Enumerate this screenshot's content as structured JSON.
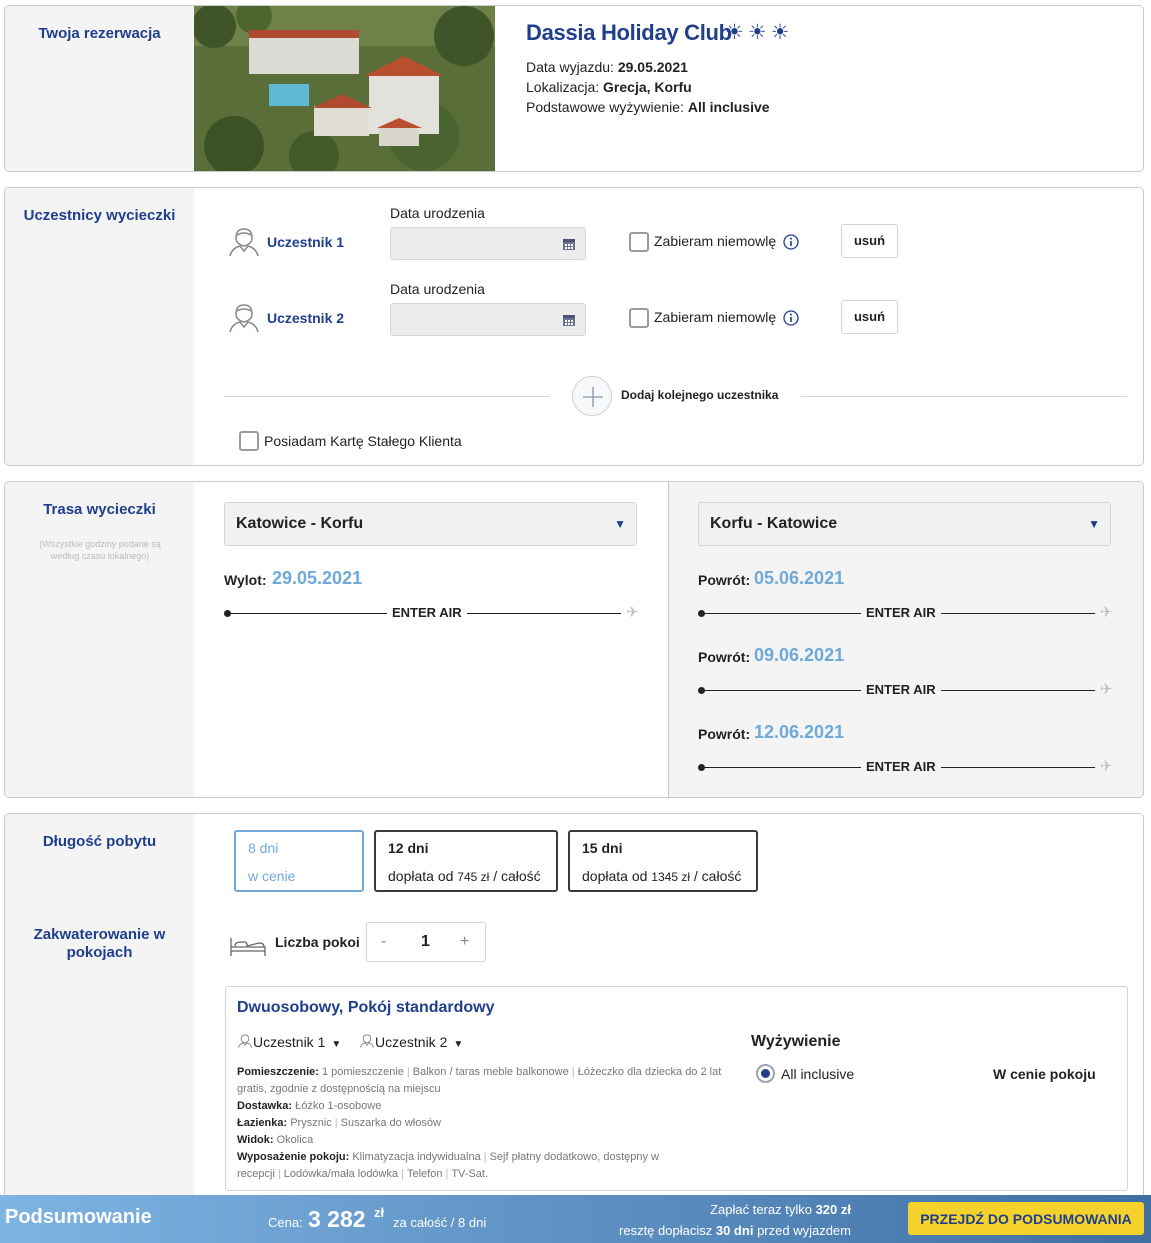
{
  "reservation": {
    "section_title": "Twoja rezerwacja",
    "hotel_name": "Dassia Holiday Club",
    "suns": "☀☀☀",
    "departure_label": "Data wyjazdu:",
    "departure_value": "29.05.2021",
    "location_label": "Lokalizacja:",
    "location_value": "Grecja, Korfu",
    "board_label": "Podstawowe wyżywienie:",
    "board_value": "All inclusive"
  },
  "participants": {
    "section_title": "Uczestnicy wycieczki",
    "items": [
      {
        "label": "Uczestnik 1",
        "dob_label": "Data urodzenia",
        "dob_value": "",
        "infant_label": "Zabieram niemowlę",
        "remove_label": "usuń"
      },
      {
        "label": "Uczestnik 2",
        "dob_label": "Data urodzenia",
        "dob_value": "",
        "infant_label": "Zabieram niemowlę",
        "remove_label": "usuń"
      }
    ],
    "add_label": "Dodaj kolejnego uczestnika",
    "loyalty_label": "Posiadam Kartę Stałego Klienta"
  },
  "route": {
    "section_title": "Trasa wycieczki",
    "note": "(Wszystkie godziny podane są według czasu lokalnego)",
    "outbound": {
      "select": "Katowice - Korfu",
      "label": "Wylot:",
      "date": "29.05.2021",
      "carrier": "ENTER AIR"
    },
    "return": {
      "select": "Korfu - Katowice",
      "flights": [
        {
          "label": "Powrót:",
          "date": "05.06.2021",
          "carrier": "ENTER AIR"
        },
        {
          "label": "Powrót:",
          "date": "09.06.2021",
          "carrier": "ENTER AIR"
        },
        {
          "label": "Powrót:",
          "date": "12.06.2021",
          "carrier": "ENTER AIR"
        }
      ]
    }
  },
  "stay": {
    "section_title": "Długość pobytu",
    "options": [
      {
        "days": "8 dni",
        "price": "w cenie",
        "selected": true
      },
      {
        "days": "12 dni",
        "price_prefix": "dopłata od",
        "amount": "745 zł",
        "suffix": "/ całość"
      },
      {
        "days": "15 dni",
        "price_prefix": "dopłata od",
        "amount": "1345 zł",
        "suffix": "/ całość"
      }
    ]
  },
  "accommodation": {
    "section_title": "Zakwaterowanie w pokojach",
    "rooms_label": "Liczba pokoi",
    "minus": "-",
    "rooms_count": "1",
    "plus": "+",
    "room": {
      "title": "Dwuosobowy, Pokój standardowy",
      "participant_1": "Uczestnik 1",
      "participant_2": "Uczestnik 2",
      "room_label": "Pomieszczenie:",
      "room_items": [
        "1 pomieszczenie",
        "Balkon / taras meble balkonowe",
        "Łóżeczko dla dziecka do 2 lat gratis, zgodnie z dostępnością na miejscu"
      ],
      "bed_label": "Dostawka:",
      "bed_value": "Łóżko 1-osobowe",
      "bath_label": "Łazienka:",
      "bath_items": [
        "Prysznic",
        "Suszarka do włosów"
      ],
      "view_label": "Widok:",
      "view_value": "Okolica",
      "equip_label": "Wyposażenie pokoju:",
      "equip_items": [
        "Klimatyzacja indywidualna",
        "Sejf płatny dodatkowo, dostępny w recepcji",
        "Lodówka/mała lodówka",
        "Telefon",
        "TV-Sat."
      ],
      "meal_heading": "Wyżywienie",
      "meal_option": "All inclusive",
      "meal_price": "W cenie pokoju"
    }
  },
  "summary": {
    "title": "Podsumowanie",
    "price_label": "Cena:",
    "price_value": "3 282",
    "currency": "zł",
    "price_suffix": "za całość / 8 dni",
    "pay_now_prefix": "Zapłać teraz tylko",
    "pay_now_value": "320 zł",
    "pay_rest_prefix": "resztę dopłacisz",
    "pay_rest_value": "30 dni",
    "pay_rest_suffix": "przed wyjazdem",
    "cta": "PRZEJDŹ DO PODSUMOWANIA"
  },
  "colors": {
    "brand_blue": "#1f3f8c",
    "accent_light_blue": "#6fa9d8",
    "cta_yellow": "#f5d22b"
  }
}
